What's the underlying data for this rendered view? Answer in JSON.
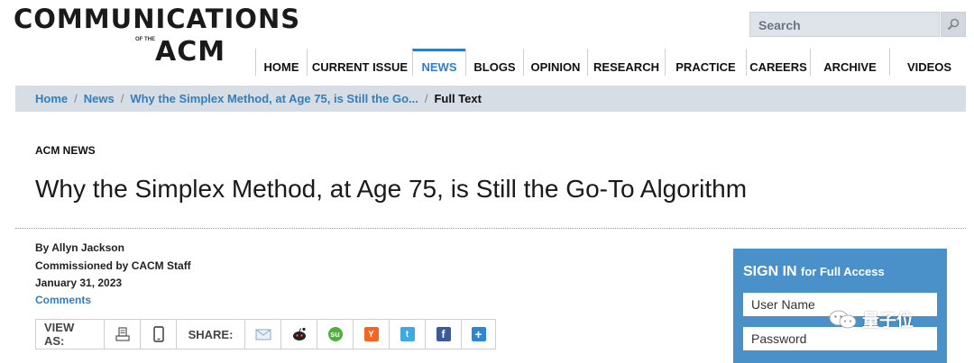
{
  "header": {
    "logo_line1": "COMMUNICATIONS",
    "logo_ofthe": "OF THE",
    "logo_line2": "ACM",
    "search_placeholder": "Search"
  },
  "nav": {
    "items": [
      {
        "label": "HOME",
        "active": false
      },
      {
        "label": "CURRENT ISSUE",
        "active": false
      },
      {
        "label": "NEWS",
        "active": true
      },
      {
        "label": "BLOGS",
        "active": false
      },
      {
        "label": "OPINION",
        "active": false
      },
      {
        "label": "RESEARCH",
        "active": false
      },
      {
        "label": "PRACTICE",
        "active": false
      },
      {
        "label": "CAREERS",
        "active": false
      },
      {
        "label": "ARCHIVE",
        "active": false
      },
      {
        "label": "VIDEOS",
        "active": false
      }
    ]
  },
  "breadcrumb": {
    "home": "Home",
    "news": "News",
    "article": "Why the Simplex Method, at Age 75, is Still the Go...",
    "current": "Full Text",
    "sep": "/"
  },
  "article": {
    "section": "ACM NEWS",
    "title": "Why the Simplex Method, at Age 75, is Still the Go-To Algorithm",
    "author": "By Allyn Jackson",
    "commissioned": "Commissioned by CACM Staff",
    "date": "January 31, 2023",
    "comments": "Comments"
  },
  "sharebar": {
    "view_as": "VIEW AS:",
    "share": "SHARE:",
    "icons": [
      "print-icon",
      "mobile-icon",
      "email-icon",
      "reddit-icon",
      "stumbleupon-icon",
      "hackernews-icon",
      "twitter-icon",
      "facebook-icon",
      "addthis-icon"
    ]
  },
  "signin": {
    "title_big": "SIGN IN",
    "title_small": "for Full Access",
    "username_placeholder": "User Name",
    "password_placeholder": "Password"
  },
  "watermark": {
    "text": "量子位"
  },
  "colors": {
    "accent": "#2f7fc1",
    "breadcrumb_bg": "#d7dde5",
    "signin_bg": "#4a90c9"
  }
}
